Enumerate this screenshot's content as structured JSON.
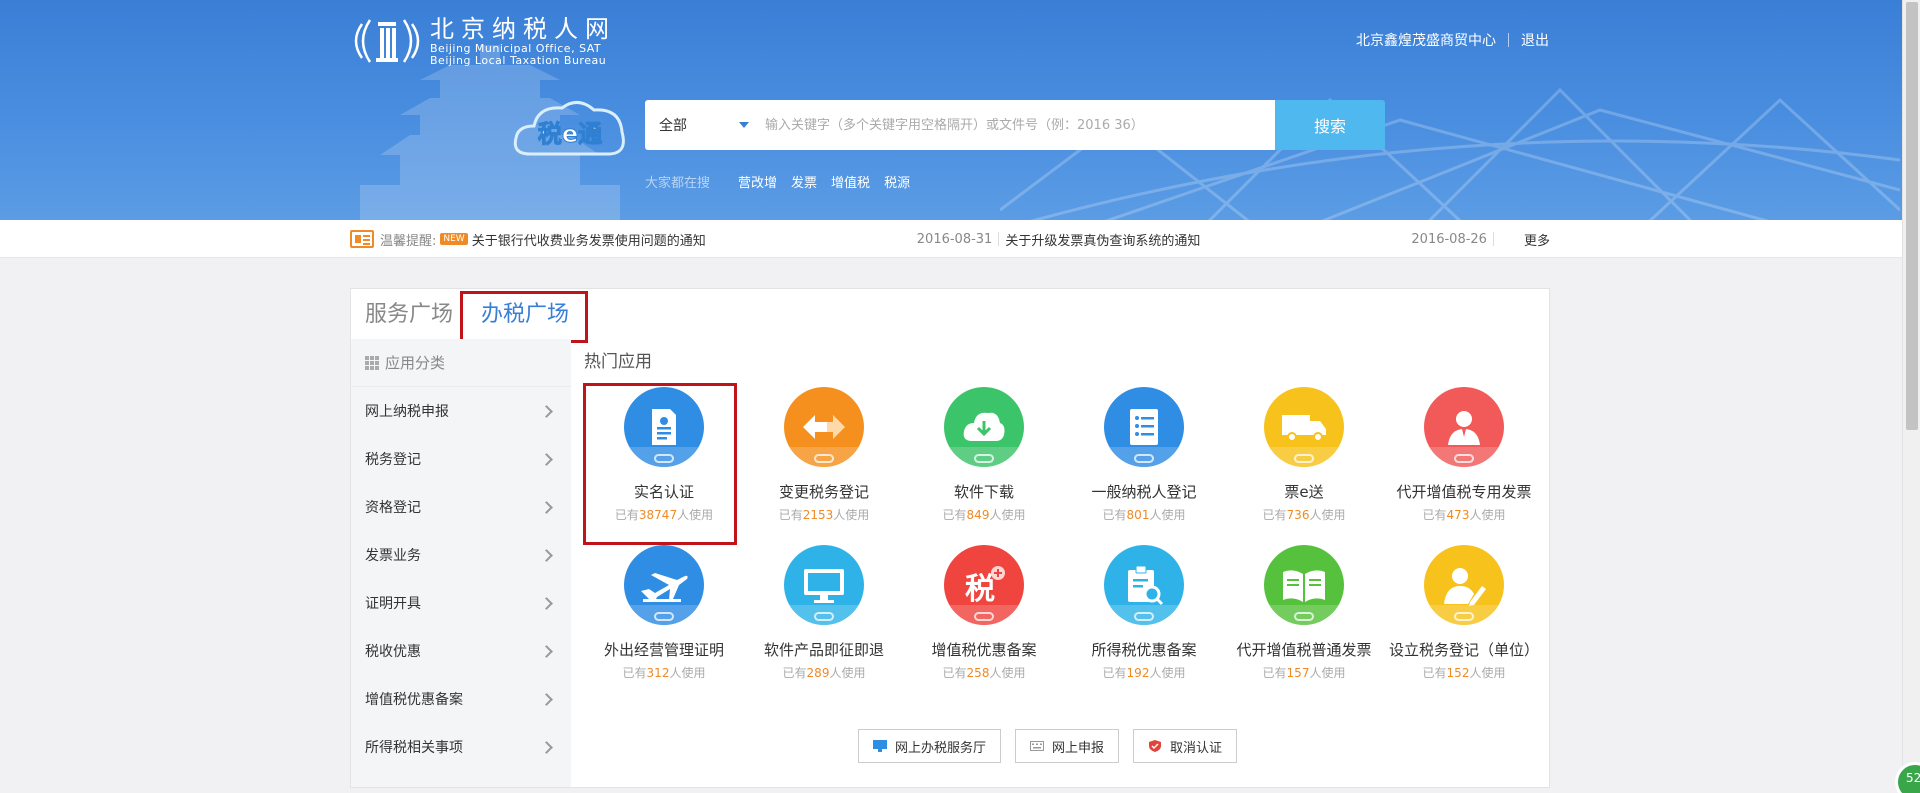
{
  "header": {
    "logo_cn": "北京纳税人网",
    "logo_en_1": "Beijing Municipal Office, SAT",
    "logo_en_2": "Beijing Local Taxation Bureau",
    "user_name": "北京鑫煌茂盛商贸中心",
    "logout": "退出"
  },
  "search": {
    "scope": "全部",
    "placeholder": "输入关键字（多个关键字用空格隔开）或文件号（例：2016 36）",
    "button": "搜索",
    "hot_label": "大家都在搜",
    "hot_keywords": [
      "营改增",
      "发票",
      "增值税",
      "税源"
    ]
  },
  "notice": {
    "tip": "温馨提醒:",
    "new_badge": "NEW",
    "items": [
      {
        "title": "关于银行代收费业务发票使用问题的通知",
        "date": "2016-08-31"
      },
      {
        "title": "关于升级发票真伪查询系统的通知",
        "date": "2016-08-26"
      }
    ],
    "more": "更多"
  },
  "tabs": [
    "服务广场",
    "办税广场"
  ],
  "sidebar": {
    "header": "应用分类",
    "items": [
      "网上纳税申报",
      "税务登记",
      "资格登记",
      "发票业务",
      "证明开具",
      "税收优惠",
      "增值税优惠备案",
      "所得税相关事项"
    ]
  },
  "hot_apps_title": "热门应用",
  "apps_row1": [
    {
      "name": "实名认证",
      "pre": "已有",
      "count": "38747",
      "post": "人使用",
      "color": "#2f8de4",
      "icon": "id-document-icon"
    },
    {
      "name": "变更税务登记",
      "pre": "已有",
      "count": "2153",
      "post": "人使用",
      "color": "#f5901e",
      "icon": "swap-arrows-icon"
    },
    {
      "name": "软件下载",
      "pre": "已有",
      "count": "849",
      "post": "人使用",
      "color": "#3cc46a",
      "icon": "cloud-download-icon"
    },
    {
      "name": "一般纳税人登记",
      "pre": "已有",
      "count": "801",
      "post": "人使用",
      "color": "#2f8de4",
      "icon": "list-document-icon"
    },
    {
      "name": "票e送",
      "pre": "已有",
      "count": "736",
      "post": "人使用",
      "color": "#f7c21b",
      "icon": "delivery-truck-icon"
    },
    {
      "name": "代开增值税专用发票",
      "pre": "已有",
      "count": "473",
      "post": "人使用",
      "color": "#f25a5a",
      "icon": "person-icon"
    }
  ],
  "apps_row2": [
    {
      "name": "外出经营管理证明",
      "pre": "已有",
      "count": "312",
      "post": "人使用",
      "color": "#2f8de4",
      "icon": "airplane-icon"
    },
    {
      "name": "软件产品即征即退",
      "pre": "已有",
      "count": "289",
      "post": "人使用",
      "color": "#2fb2e8",
      "icon": "monitor-icon"
    },
    {
      "name": "增值税优惠备案",
      "pre": "已有",
      "count": "258",
      "post": "人使用",
      "color": "#f0443f",
      "icon": "tax-plus-icon"
    },
    {
      "name": "所得税优惠备案",
      "pre": "已有",
      "count": "192",
      "post": "人使用",
      "color": "#2fb2e8",
      "icon": "clipboard-search-icon"
    },
    {
      "name": "代开增值税普通发票",
      "pre": "已有",
      "count": "157",
      "post": "人使用",
      "color": "#56c13c",
      "icon": "open-book-icon"
    },
    {
      "name": "设立税务登记（单位）",
      "pre": "已有",
      "count": "152",
      "post": "人使用",
      "color": "#f7c21b",
      "icon": "person-edit-icon"
    }
  ],
  "actions": [
    "网上办税服务厅",
    "网上申报",
    "取消认证"
  ],
  "corner_badge": "52"
}
